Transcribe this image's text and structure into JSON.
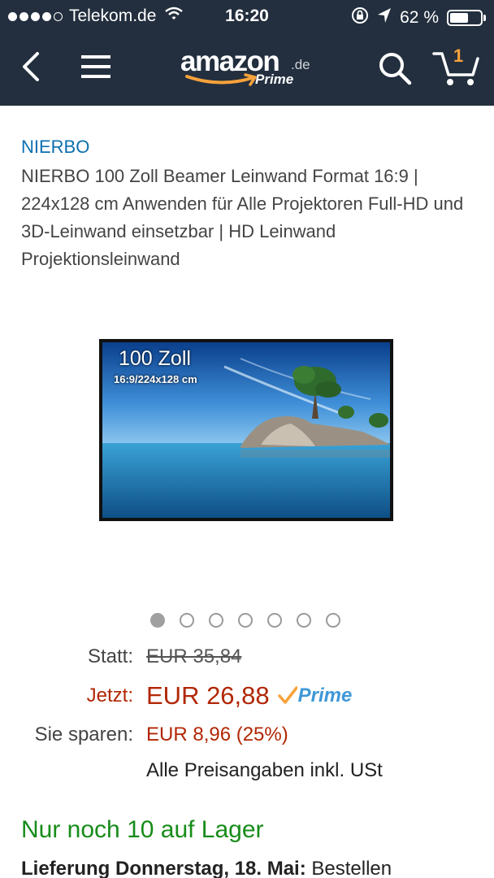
{
  "status_bar": {
    "carrier": "Telekom.de",
    "time": "16:20",
    "battery_percent": "62 %",
    "battery_level": 0.62,
    "signal_bars": 4,
    "signal_total": 5
  },
  "nav": {
    "logo_word": "amazon",
    "logo_tld": ".de",
    "logo_prime": "Prime",
    "cart_count": "1",
    "accent_color": "#f7a23b",
    "background_color": "#232f3e"
  },
  "product": {
    "brand": "NIERBO",
    "title": "NIERBO 100 Zoll Beamer Leinwand Format 16:9 | 224x128 cm Anwenden für Alle Projektoren Full-HD und 3D-Leinwand einsetzbar | HD Leinwand Projektionsleinwand",
    "image_title": "100 Zoll",
    "image_subtitle": "16:9/224x128 cm",
    "image_count": 7,
    "active_image_index": 0
  },
  "pricing": {
    "was_label": "Statt:",
    "was_price": "EUR 35,84",
    "now_label": "Jetzt:",
    "now_price": "EUR 26,88",
    "prime_label": "Prime",
    "save_label": "Sie sparen:",
    "save_value": "EUR 8,96 (25%)",
    "tax_note": "Alle Preisangaben inkl. USt",
    "price_color": "#b12704",
    "prime_color": "#3f98d6"
  },
  "availability": {
    "stock": "Nur noch 10 auf Lager",
    "stock_color": "#188c1a",
    "delivery_bold": "Lieferung Donnerstag, 18. Mai:",
    "delivery_rest": "Bestellen"
  }
}
